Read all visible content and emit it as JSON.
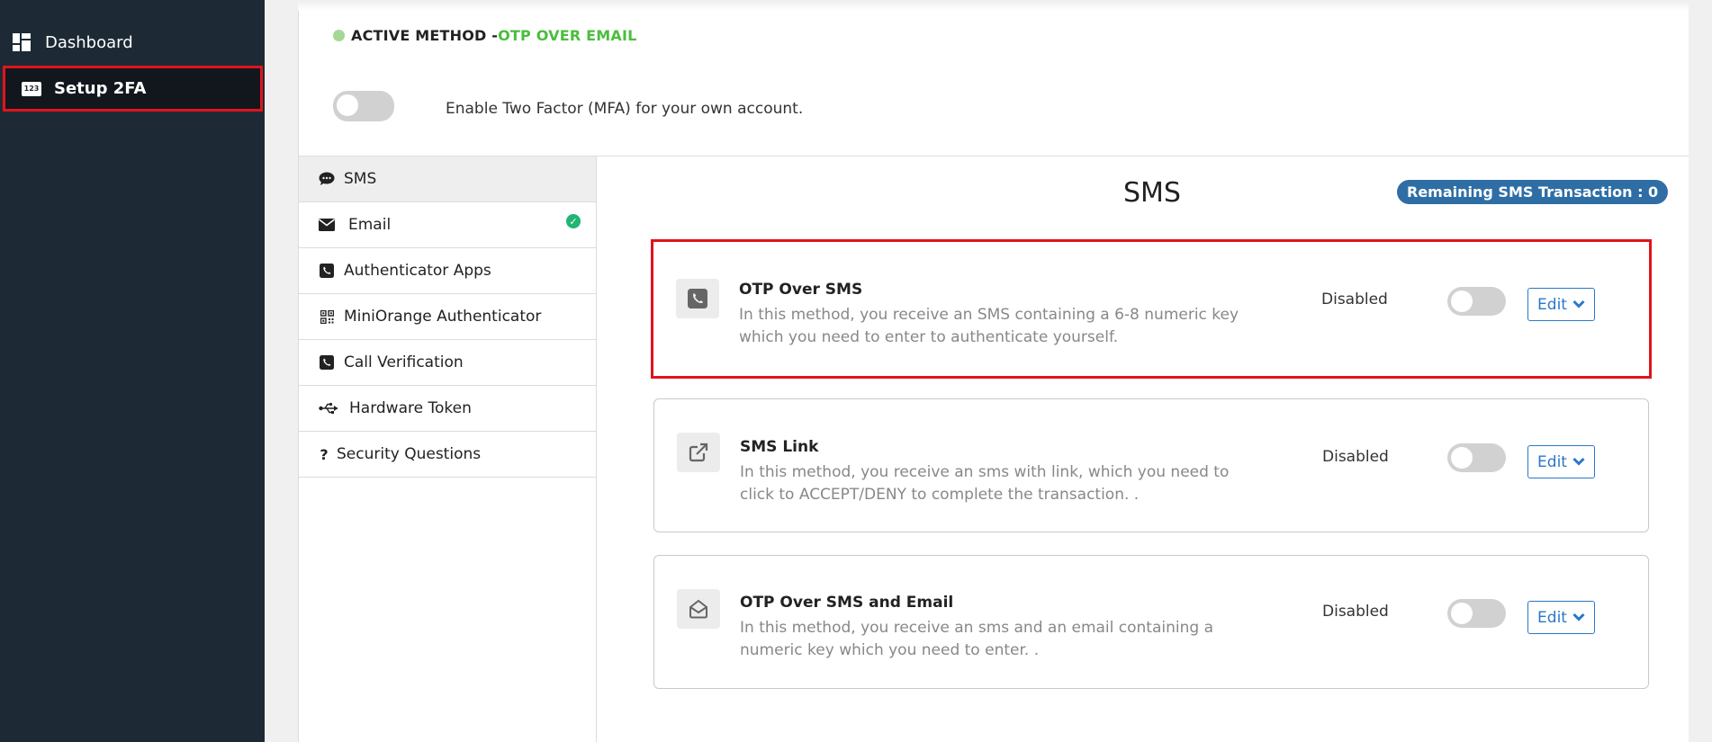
{
  "sidebar": {
    "items": [
      {
        "label": "Dashboard",
        "icon": "dashboard-icon"
      },
      {
        "label": "Setup 2FA",
        "icon": "numpad-123-icon",
        "badge_text": "123"
      }
    ]
  },
  "header": {
    "active_prefix": "ACTIVE METHOD - ",
    "active_method": "OTP OVER EMAIL",
    "mfa_toggle_label": "Enable Two Factor (MFA) for your own account.",
    "mfa_enabled": false
  },
  "methods": [
    {
      "label": "SMS",
      "icon": "comment-icon",
      "selected": true
    },
    {
      "label": "Email",
      "icon": "envelope-icon",
      "configured": true
    },
    {
      "label": "Authenticator Apps",
      "icon": "phone-square-icon"
    },
    {
      "label": "MiniOrange Authenticator",
      "icon": "qrcode-icon"
    },
    {
      "label": "Call Verification",
      "icon": "phone-square-icon"
    },
    {
      "label": "Hardware Token",
      "icon": "usb-icon"
    },
    {
      "label": "Security Questions",
      "icon": "question-icon"
    }
  ],
  "content": {
    "title": "SMS",
    "remaining_label": "Remaining SMS Transaction : 0",
    "cards": [
      {
        "title": "OTP Over SMS",
        "description": "In this method, you receive an SMS containing a 6-8 numeric key which you need to enter to authenticate yourself.",
        "status": "Disabled",
        "edit_label": "Edit",
        "icon": "phone-square-icon",
        "enabled": false
      },
      {
        "title": "SMS Link",
        "description": "In this method, you receive an sms with link, which you need to click to ACCEPT/DENY to complete the transaction. .",
        "status": "Disabled",
        "edit_label": "Edit",
        "icon": "external-link-icon",
        "enabled": false
      },
      {
        "title": "OTP Over SMS and Email",
        "description": "In this method, you receive an sms and an email containing a numeric key which you need to enter. .",
        "status": "Disabled",
        "edit_label": "Edit",
        "icon": "envelope-open-icon",
        "enabled": false
      }
    ]
  },
  "colors": {
    "sidebar_bg": "#1d2a35",
    "highlight_border": "#e0141c",
    "active_method_green": "#4bbd3d",
    "badge_blue": "#2f6ea5",
    "edit_blue": "#2a78c8"
  }
}
